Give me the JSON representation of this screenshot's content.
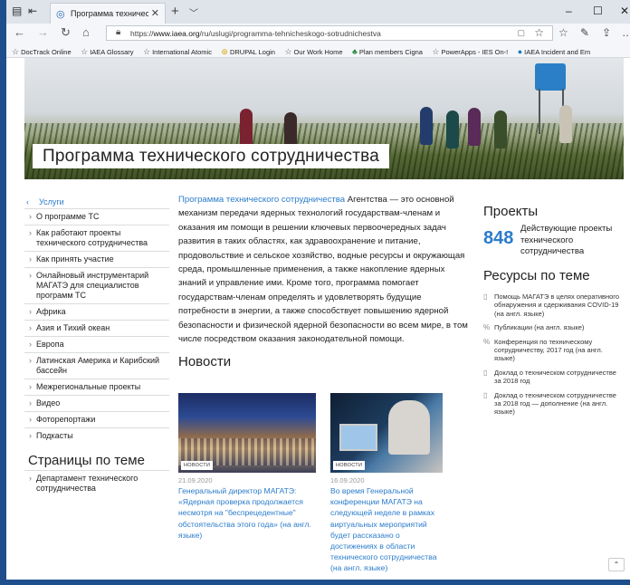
{
  "browser": {
    "tab_title": "Программа техническо",
    "url_prefix": "https://",
    "url_host": "www.iaea.org",
    "url_path": "/ru/uslugi/programma-tehnicheskogo-sotrudnichestva",
    "favorites": [
      "DocTrack Online",
      "IAEA Glossary",
      "International Atomic",
      "DRUPAL Login",
      "Our Work Home",
      "Plan members Cigna",
      "PowerApps - IES On-!",
      "IAEA Incident and Em"
    ]
  },
  "hero": {
    "title": "Программа технического сотрудничества"
  },
  "sidebar": {
    "active": "Услуги",
    "items": [
      "О программе ТС",
      "Как работают проекты технического сотрудничества",
      "Как принять участие",
      "Онлайновый инструментарий МАГАТЭ для специалистов программ ТС",
      "Африка",
      "Азия и Тихий океан",
      "Европа",
      "Латинская Америка и Карибский бассейн",
      "Межрегиональные проекты",
      "Видео",
      "Фоторепортажи",
      "Подкасты"
    ],
    "related_title": "Страницы по теме",
    "related_items": [
      "Департамент технического сотрудничества"
    ]
  },
  "main": {
    "intro_link": "Программа технического сотрудничества",
    "intro_text": " Агентства — это основной механизм передачи ядерных технологий государствам-членам и оказания им помощи в решении ключевых первоочередных задач развития в таких областях, как здравоохранение и питание, продовольствие и сельское хозяйство, водные ресурсы и окружающая среда, промышленные применения, а также накопление ядерных знаний и управление ими. Кроме того, программа помогает государствам-членам определять и удовлетворять будущие потребности в энергии, а также способствует повышению ядерной безопасности и физической ядерной безопасности во всем мире, в том числе посредством оказания законодательной помощи.",
    "news_title": "Новости",
    "news": [
      {
        "badge": "НОВОСТИ",
        "date": "21.09.2020",
        "title": "Генеральный директор МАГАТЭ: «Ядерная проверка продолжается несмотря на \"беспрецедентные\" обстоятельства этого года» (на англ. языке)"
      },
      {
        "badge": "НОВОСТИ",
        "date": "16.09.2020",
        "title": "Во время Генеральной конференции МАГАТЭ на следующей неделе в рамках виртуальных мероприятий будет рассказано о достижениях в области технического сотрудничества (на англ. языке)"
      }
    ]
  },
  "right": {
    "projects_title": "Проекты",
    "projects_count": "848",
    "projects_label": "Действующие проекты технического сотрудничества",
    "resources_title": "Ресурсы по теме",
    "resources": [
      {
        "icon": "document-icon",
        "text": "Помощь МАГАТЭ в целях оперативного обнаружения и сдерживания COVID-19 (на англ. языке)"
      },
      {
        "icon": "link-icon",
        "text": "Публикации (на англ. языке)"
      },
      {
        "icon": "link-icon",
        "text": "Конференция по техническому сотрудничеству, 2017 год (на англ. языке)"
      },
      {
        "icon": "document-icon",
        "text": "Доклад о техническом сотрудничестве за 2018 год"
      },
      {
        "icon": "document-icon",
        "text": "Доклад о техническом сотрудничестве за 2018 год — дополнение (на англ. языке)"
      }
    ]
  },
  "colors": {
    "link": "#2b7ccb",
    "frame": "#1e4f8c"
  }
}
